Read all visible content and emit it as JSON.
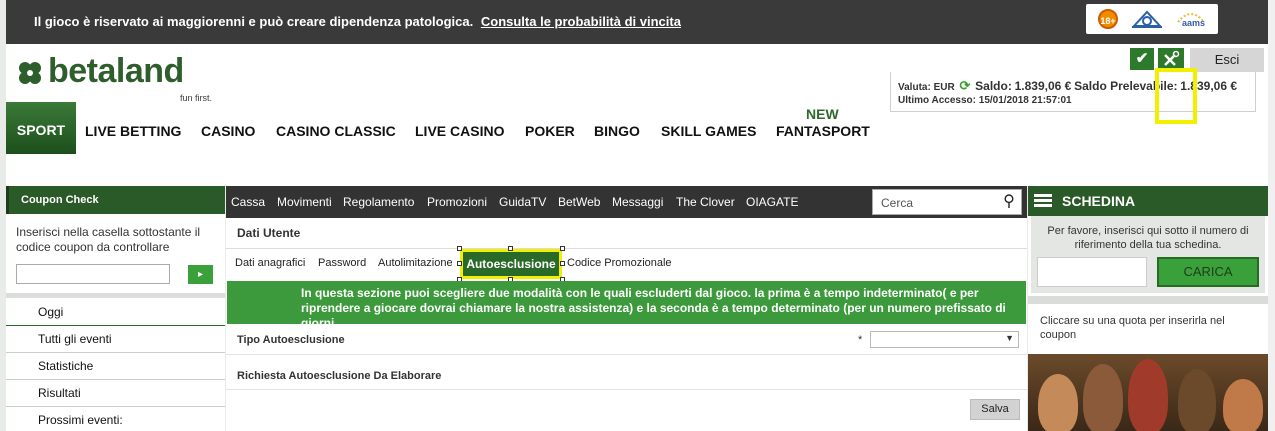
{
  "warning": {
    "text": "Il gioco è riservato ai maggiorenni e può creare dipendenza patologica.",
    "link": "Consulta le probabilità di vincita",
    "badges": {
      "age": "18+",
      "aams": "aams"
    }
  },
  "logo": {
    "name": "betaland",
    "tagline": "fun first."
  },
  "nav": {
    "items": [
      "SPORT",
      "LIVE BETTING",
      "CASINO",
      "CASINO CLASSIC",
      "LIVE CASINO",
      "POKER",
      "BINGO",
      "SKILL GAMES",
      "FANTASPORT"
    ],
    "new_label": "NEW"
  },
  "account": {
    "logout_label": "Esci",
    "valuta_label": "Valuta:",
    "valuta": "EUR",
    "saldo_label": "Saldo:",
    "saldo": "1.839,06 €",
    "prelevabile_label": "Saldo Prelevabile:",
    "prelevabile": "1.839,06 €",
    "accesso_label": "Ultimo Accesso:",
    "accesso": "15/01/2018 21:57:01"
  },
  "coupon": {
    "title": "Coupon Check",
    "description": "Inserisci nella casella sottostante il codice coupon da controllare",
    "go": "▸"
  },
  "left_menu": [
    "Oggi",
    "Tutti gli eventi",
    "Statistiche",
    "Risultati",
    "Prossimi eventi:"
  ],
  "topnav": {
    "items": [
      "Cassa",
      "Movimenti",
      "Regolamento",
      "Promozioni",
      "GuidaTV",
      "BetWeb",
      "Messaggi",
      "The Clover",
      "OIAGATE"
    ],
    "search_placeholder": "Cerca"
  },
  "dati_utente": {
    "title": "Dati Utente",
    "tabs": [
      "Dati anagrafici",
      "Password",
      "Autolimitazione",
      "Autoesclusione",
      "Codice Promozionale"
    ],
    "active_tab": "Autoesclusione",
    "info": "In questa sezione puoi scegliere due modalità con le quali escluderti dal gioco. la prima è a tempo indeterminato( e per riprendere a giocare dovrai chiamare la nostra assistenza) e la seconda è a tempo determinato (per un numero prefissato di giorni",
    "tipo_label": "Tipo Autoesclusione",
    "required_mark": "*",
    "select_value": "",
    "richiesta_label": "Richiesta Autoesclusione Da Elaborare",
    "save_label": "Salva"
  },
  "schedina": {
    "title": "SCHEDINA",
    "description": "Per favore, inserisci qui sotto il numero di riferimento della tua schedina.",
    "button": "CARICA",
    "hint": "Cliccare su una quota per inserirla nel coupon"
  },
  "colors": {
    "brand_green": "#2a5a28",
    "accent_green": "#3c9a3c",
    "highlight": "#f0f000",
    "dark_bar": "#333333"
  }
}
